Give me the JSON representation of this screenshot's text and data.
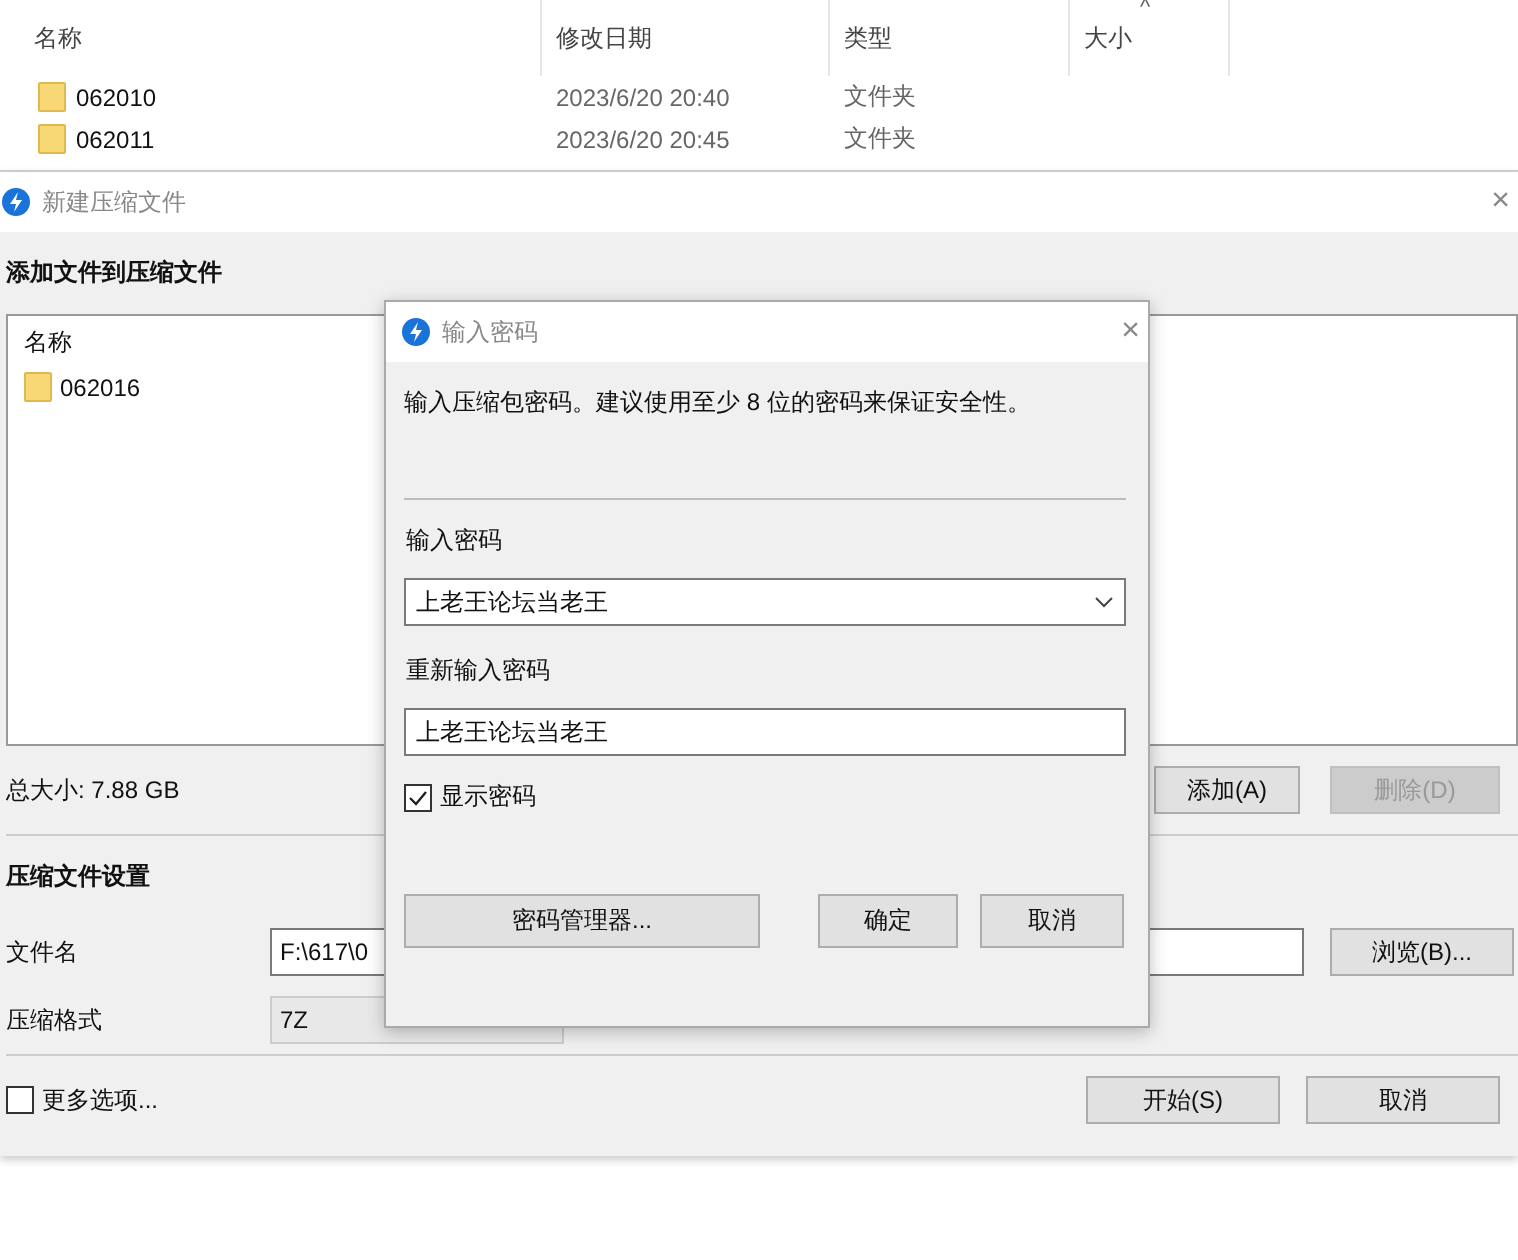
{
  "explorer": {
    "columns": [
      "名称",
      "修改日期",
      "类型",
      "大小"
    ],
    "sort_indicator": "^",
    "rows": [
      {
        "name": "062010",
        "date": "2023/6/20 20:40",
        "type": "文件夹"
      },
      {
        "name": "062011",
        "date": "2023/6/20 20:45",
        "type": "文件夹"
      }
    ]
  },
  "archive_window": {
    "title": "新建压缩文件",
    "close": "×",
    "section_files": "添加文件到压缩文件",
    "list_header": "名称",
    "files": [
      {
        "name": "062016"
      }
    ],
    "total_size": "总大小: 7.88 GB",
    "add_button": {
      "label": "添加(A)",
      "disabled": false
    },
    "delete_button": {
      "label": "删除(D)",
      "disabled": true
    },
    "section_settings": "压缩文件设置",
    "filename_label": "文件名",
    "filename_value": "F:\\617\\0",
    "browse_button": "浏览(B)...",
    "format_label": "压缩格式",
    "format_value": "7Z",
    "more_options": {
      "label": "更多选项...",
      "checked": false
    },
    "start_button": "开始(S)",
    "cancel_button": "取消"
  },
  "password_dialog": {
    "title": "输入密码",
    "close": "×",
    "description": "输入压缩包密码。建议使用至少 8 位的密码来保证安全性。",
    "password_label": "输入密码",
    "password_value": "上老王论坛当老王",
    "confirm_label": "重新输入密码",
    "confirm_value": "上老王论坛当老王",
    "show_password": {
      "label": "显示密码",
      "checked": true
    },
    "buttons": [
      "密码管理器...",
      "确定",
      "取消"
    ]
  }
}
